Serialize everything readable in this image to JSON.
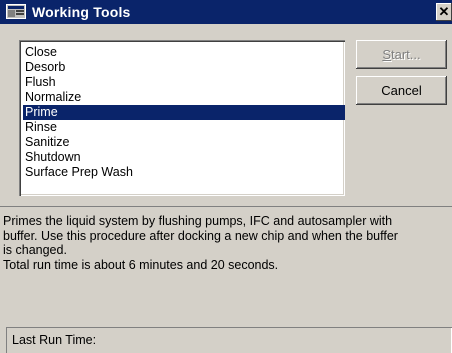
{
  "window": {
    "title": "Working Tools",
    "close_glyph": "✕",
    "icon": "app-window-icon"
  },
  "procedures": {
    "items": [
      {
        "label": "Close",
        "selected": false
      },
      {
        "label": "Desorb",
        "selected": false
      },
      {
        "label": "Flush",
        "selected": false
      },
      {
        "label": "Normalize",
        "selected": false
      },
      {
        "label": "Prime",
        "selected": true
      },
      {
        "label": "Rinse",
        "selected": false
      },
      {
        "label": "Sanitize",
        "selected": false
      },
      {
        "label": "Shutdown",
        "selected": false
      },
      {
        "label": "Surface Prep Wash",
        "selected": false
      }
    ]
  },
  "buttons": {
    "start": {
      "mnemonic": "S",
      "rest": "tart...",
      "enabled": false
    },
    "cancel": {
      "label": "Cancel",
      "enabled": true
    }
  },
  "description": {
    "text": "Primes the liquid system by flushing pumps, IFC and autosampler with\nbuffer. Use this procedure after docking a new chip and when the buffer\nis changed.\nTotal run time is about 6 minutes and 20 seconds."
  },
  "status": {
    "last_run_label": "Last Run Time:"
  },
  "colors": {
    "titlebar": "#0a246a",
    "face": "#d4d0c8",
    "selection": "#0a246a"
  }
}
